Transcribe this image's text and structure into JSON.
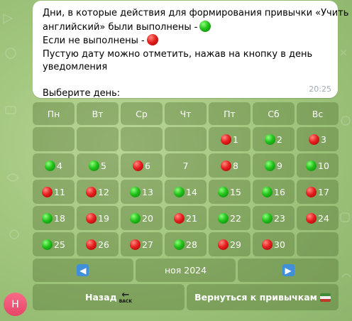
{
  "message": {
    "lines": [
      "Дни, в которые действия для формирования привычки «Учить",
      "английский» были выполнены -",
      "Если не выполнены -",
      "Пустую дату можно отметить, нажав на кнопку в день",
      "уведомления",
      "",
      "Выберите день:"
    ],
    "time": "20:25"
  },
  "calendar": {
    "weekdays": [
      "Пн",
      "Вт",
      "Ср",
      "Чт",
      "Пт",
      "Сб",
      "Вс"
    ],
    "weeks": [
      [
        null,
        null,
        null,
        null,
        {
          "day": "1",
          "status": "red"
        },
        {
          "day": "2",
          "status": "green"
        },
        {
          "day": "3",
          "status": "red"
        }
      ],
      [
        {
          "day": "4",
          "status": "green"
        },
        {
          "day": "5",
          "status": "green"
        },
        {
          "day": "6",
          "status": "red"
        },
        {
          "day": "7",
          "status": "none"
        },
        {
          "day": "8",
          "status": "red"
        },
        {
          "day": "9",
          "status": "green"
        },
        {
          "day": "10",
          "status": "green"
        }
      ],
      [
        {
          "day": "11",
          "status": "red"
        },
        {
          "day": "12",
          "status": "red"
        },
        {
          "day": "13",
          "status": "green"
        },
        {
          "day": "14",
          "status": "green"
        },
        {
          "day": "15",
          "status": "green"
        },
        {
          "day": "16",
          "status": "green"
        },
        {
          "day": "17",
          "status": "red"
        }
      ],
      [
        {
          "day": "18",
          "status": "green"
        },
        {
          "day": "19",
          "status": "red"
        },
        {
          "day": "20",
          "status": "green"
        },
        {
          "day": "21",
          "status": "red"
        },
        {
          "day": "22",
          "status": "green"
        },
        {
          "day": "23",
          "status": "green"
        },
        {
          "day": "24",
          "status": "red"
        }
      ],
      [
        {
          "day": "25",
          "status": "green"
        },
        {
          "day": "26",
          "status": "red"
        },
        {
          "day": "27",
          "status": "red"
        },
        {
          "day": "28",
          "status": "green"
        },
        {
          "day": "29",
          "status": "red"
        },
        {
          "day": "30",
          "status": "red"
        },
        null
      ]
    ],
    "month_label": "ноя 2024",
    "prev_icon": "left-arrow-icon",
    "next_icon": "right-arrow-icon"
  },
  "buttons": {
    "back": "Назад",
    "back_icon_text": "BACK",
    "return": "Вернуться к привычкам"
  },
  "avatar": {
    "letter": "Н"
  },
  "colors": {
    "green_status": "#1fbf18",
    "red_status": "#e62020",
    "arrow_button": "#3f8fd9",
    "avatar": "#f1557a"
  }
}
